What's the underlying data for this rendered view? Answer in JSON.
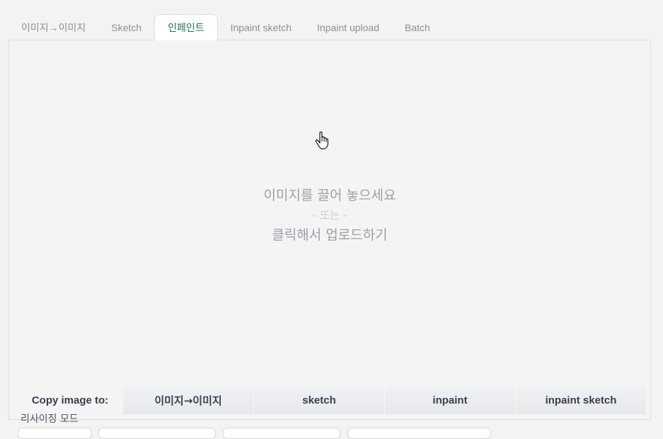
{
  "tabs": [
    {
      "label": "이미지→이미지",
      "active": false
    },
    {
      "label": "Sketch",
      "active": false
    },
    {
      "label": "인페인트",
      "active": true
    },
    {
      "label": "Inpaint sketch",
      "active": false
    },
    {
      "label": "Inpaint upload",
      "active": false
    },
    {
      "label": "Batch",
      "active": false
    }
  ],
  "drop_zone": {
    "line1": "이미지를 끌어 놓으세요",
    "line2": "- 또는 -",
    "line3": "클릭해서 업로드하기"
  },
  "copy": {
    "label": "Copy image to:",
    "buttons": [
      "이미지→이미지",
      "sketch",
      "inpaint",
      "inpaint sketch"
    ]
  },
  "resize_mode": {
    "label": "리사이징 모드"
  },
  "colors": {
    "active_tab_text": "#1f7a4f",
    "tab_text": "#8a8f98",
    "background": "#f3f3f3"
  }
}
